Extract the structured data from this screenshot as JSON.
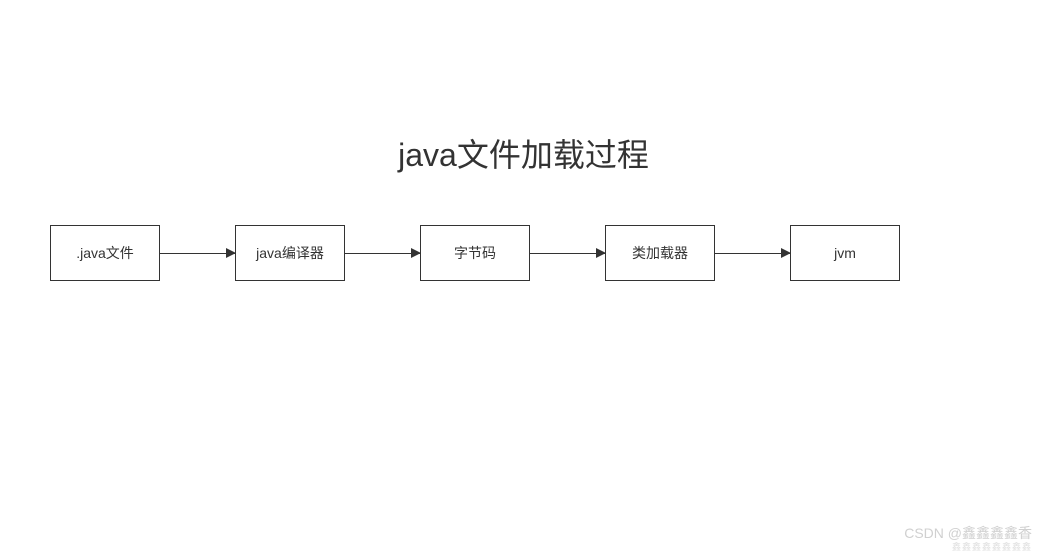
{
  "title": "java文件加载过程",
  "boxes": [
    ".java文件",
    "java编译器",
    "字节码",
    "类加载器",
    "jvm"
  ],
  "watermark": "CSDN @鑫鑫鑫鑫香",
  "watermark_sub": "鑫鑫鑫鑫鑫鑫鑫鑫"
}
